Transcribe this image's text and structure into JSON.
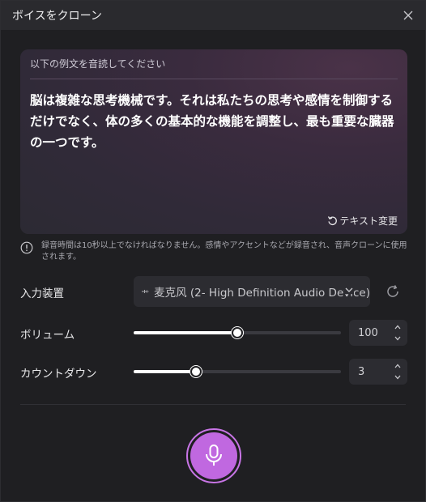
{
  "window": {
    "title": "ボイスをクローン"
  },
  "script_card": {
    "label": "以下の例文を音読してください",
    "text": "脳は複雑な思考機械です。それは私たちの思考や感情を制御するだけでなく、体の多くの基本的な機能を調整し、最も重要な臓器の一つです。",
    "change_text_label": "テキスト変更"
  },
  "notice": {
    "text": "録音時間は10秒以上でなければなりません。感情やアクセントなどが録音され、音声クローンに使用されます。"
  },
  "input_device": {
    "label": "入力装置",
    "selected": "麦克风 (2- High Definition Audio Device)"
  },
  "volume": {
    "label": "ボリューム",
    "value": "100",
    "slider_fraction": 0.5
  },
  "countdown": {
    "label": "カウントダウン",
    "value": "3",
    "slider_fraction": 0.3
  },
  "icons": {
    "close": "close-icon",
    "refresh_text": "rotate-icon",
    "info": "info-icon",
    "waveform": "waveform-icon",
    "chevron": "chevron-down-icon",
    "refresh_device": "refresh-icon",
    "mic": "microphone-icon"
  },
  "colors": {
    "accent": "#c068e0",
    "background": "#1f1f22",
    "titlebar": "#2a2a2e"
  }
}
